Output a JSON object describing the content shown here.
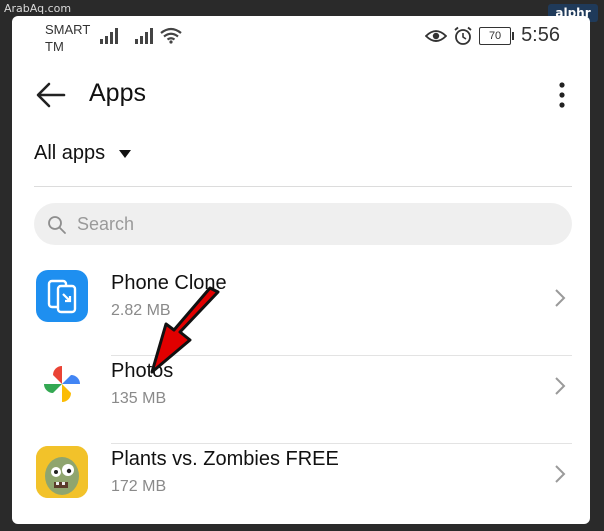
{
  "watermark": "ArabAq.com",
  "brand": "alphr",
  "status_bar": {
    "carrier_line1": "SMART",
    "carrier_line2": "TM",
    "battery": "70",
    "time": "5:56"
  },
  "header": {
    "title": "Apps"
  },
  "filter": {
    "label": "All apps"
  },
  "search": {
    "placeholder": "Search"
  },
  "apps": [
    {
      "name": "Phone Clone",
      "size": "2.82 MB",
      "icon": "phone-clone-icon"
    },
    {
      "name": "Photos",
      "size": "135 MB",
      "icon": "google-photos-icon"
    },
    {
      "name": "Plants vs. Zombies FREE",
      "size": "172 MB",
      "icon": "zombie-icon"
    }
  ],
  "colors": {
    "accent_arrow": "#e10000",
    "phone_clone_blue": "#1e8ff0",
    "zombie_yellow": "#f2c22a"
  }
}
